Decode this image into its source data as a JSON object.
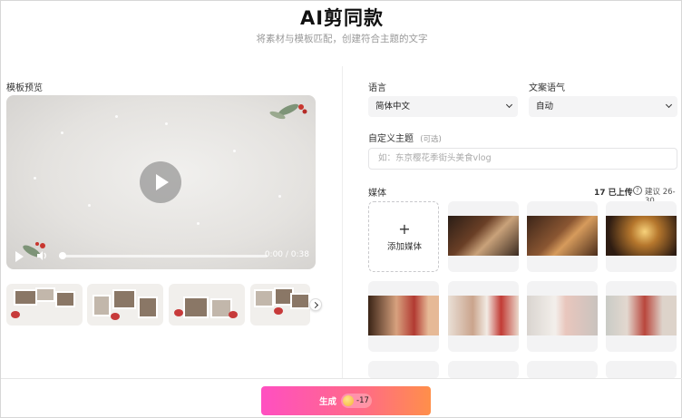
{
  "header": {
    "title": "AI剪同款",
    "subtitle": "将素材与模板匹配，创建符合主题的文字"
  },
  "preview": {
    "label": "模板预览",
    "time": "0:00 / 0:38"
  },
  "settings": {
    "language_label": "语言",
    "language_value": "简体中文",
    "tone_label": "文案语气",
    "tone_value": "自动",
    "theme_label": "自定义主题",
    "theme_optional": "(可选)",
    "theme_placeholder": "如：东京樱花季街头美食vlog"
  },
  "media": {
    "label": "媒体",
    "uploaded": "17 已上传",
    "help_glyph": "?",
    "suggest": "建议 26-30",
    "add_label": "添加媒体",
    "add_glyph": "+"
  },
  "footer": {
    "generate_label": "生成",
    "cost": "-17"
  }
}
